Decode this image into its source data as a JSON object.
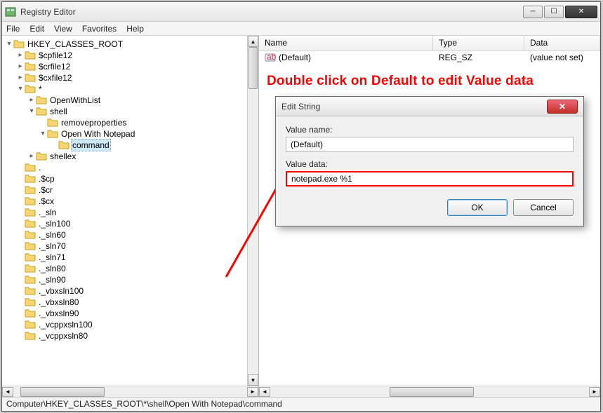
{
  "window": {
    "title": "Registry Editor"
  },
  "menu": [
    "File",
    "Edit",
    "View",
    "Favorites",
    "Help"
  ],
  "tree": [
    {
      "indent": 0,
      "tw": "▾",
      "label": "HKEY_CLASSES_ROOT"
    },
    {
      "indent": 1,
      "tw": "▸",
      "label": "$cpfile12"
    },
    {
      "indent": 1,
      "tw": "▸",
      "label": "$crfile12"
    },
    {
      "indent": 1,
      "tw": "▸",
      "label": "$cxfile12"
    },
    {
      "indent": 1,
      "tw": "▾",
      "label": "*"
    },
    {
      "indent": 2,
      "tw": "▸",
      "label": "OpenWithList"
    },
    {
      "indent": 2,
      "tw": "▾",
      "label": "shell"
    },
    {
      "indent": 3,
      "tw": "",
      "label": "removeproperties"
    },
    {
      "indent": 3,
      "tw": "▾",
      "label": "Open With Notepad"
    },
    {
      "indent": 4,
      "tw": "",
      "label": "command",
      "sel": true
    },
    {
      "indent": 2,
      "tw": "▸",
      "label": "shellex"
    },
    {
      "indent": 1,
      "tw": "",
      "label": "."
    },
    {
      "indent": 1,
      "tw": "",
      "label": ".$cp"
    },
    {
      "indent": 1,
      "tw": "",
      "label": ".$cr"
    },
    {
      "indent": 1,
      "tw": "",
      "label": ".$cx"
    },
    {
      "indent": 1,
      "tw": "",
      "label": "._sln"
    },
    {
      "indent": 1,
      "tw": "",
      "label": "._sln100"
    },
    {
      "indent": 1,
      "tw": "",
      "label": "._sln60"
    },
    {
      "indent": 1,
      "tw": "",
      "label": "._sln70"
    },
    {
      "indent": 1,
      "tw": "",
      "label": "._sln71"
    },
    {
      "indent": 1,
      "tw": "",
      "label": "._sln80"
    },
    {
      "indent": 1,
      "tw": "",
      "label": "._sln90"
    },
    {
      "indent": 1,
      "tw": "",
      "label": "._vbxsln100"
    },
    {
      "indent": 1,
      "tw": "",
      "label": "._vbxsln80"
    },
    {
      "indent": 1,
      "tw": "",
      "label": "._vbxsln90"
    },
    {
      "indent": 1,
      "tw": "",
      "label": "._vcppxsln100"
    },
    {
      "indent": 1,
      "tw": "",
      "label": "._vcppxsln80"
    }
  ],
  "list": {
    "columns": [
      "Name",
      "Type",
      "Data"
    ],
    "rows": [
      {
        "name": "(Default)",
        "type": "REG_SZ",
        "data": "(value not set)"
      }
    ]
  },
  "annotation": "Double click on Default to edit Value data",
  "dialog": {
    "title": "Edit String",
    "value_name_label": "Value name:",
    "value_name": "(Default)",
    "value_data_label": "Value data:",
    "value_data": "notepad.exe %1",
    "ok": "OK",
    "cancel": "Cancel"
  },
  "statusbar": "Computer\\HKEY_CLASSES_ROOT\\*\\shell\\Open With Notepad\\command"
}
